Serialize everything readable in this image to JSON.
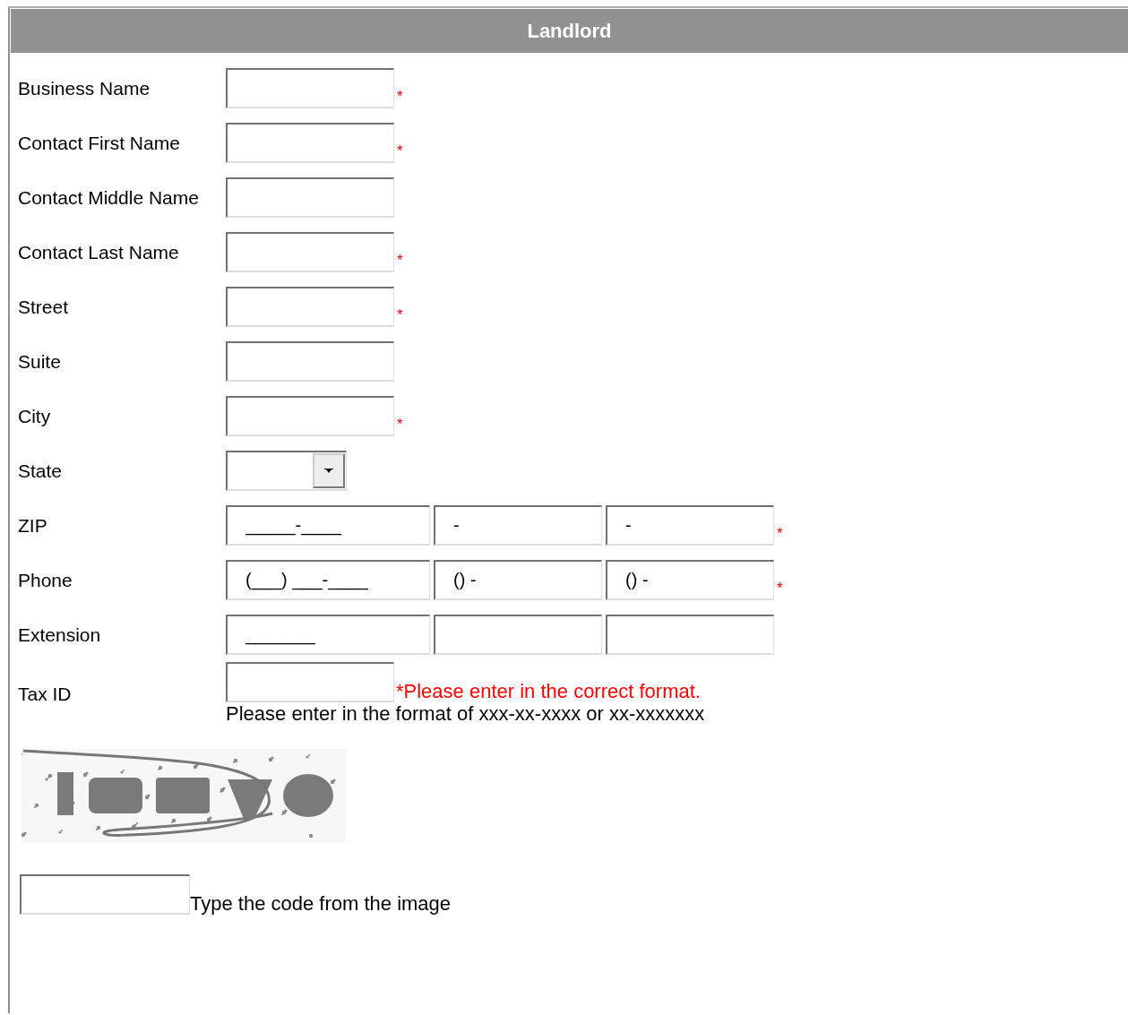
{
  "section": {
    "title": "Landlord"
  },
  "fields": [
    {
      "label": "Business Name",
      "kind": "text",
      "required_mark": "*"
    },
    {
      "label": "Contact First Name",
      "kind": "text",
      "required_mark": "*"
    },
    {
      "label": "Contact Middle Name",
      "kind": "text"
    },
    {
      "label": "Contact Last Name",
      "kind": "text",
      "required_mark": "*"
    },
    {
      "label": "Street",
      "kind": "text",
      "required_mark": "*"
    },
    {
      "label": "Suite",
      "kind": "text"
    },
    {
      "label": "City",
      "kind": "text",
      "required_mark": "*"
    },
    {
      "label": "State",
      "kind": "select"
    },
    {
      "label": "ZIP",
      "kind": "multi",
      "required_mark": "*",
      "inputs": [
        {
          "kind": "filled",
          "value": "_____-____"
        },
        {
          "kind": "filled",
          "value": "-"
        },
        {
          "kind": "filled",
          "value": "-"
        }
      ]
    },
    {
      "label": "Phone",
      "kind": "multi",
      "required_mark": "*",
      "inputs": [
        {
          "kind": "filled",
          "value": "(___) ___-____"
        },
        {
          "kind": "filled",
          "value": "() -"
        },
        {
          "kind": "filled",
          "value": "() -"
        }
      ]
    },
    {
      "label": "Extension",
      "kind": "multi",
      "inputs": [
        {
          "kind": "filled",
          "value": "_______"
        },
        {
          "kind": "empty"
        },
        {
          "kind": "empty"
        }
      ]
    },
    {
      "label": "Tax ID",
      "kind": "text",
      "error": "*Please enter in the correct format.",
      "hint": "Please enter in the format of xxx-xx-xxxx or xx-xxxxxxx"
    }
  ],
  "captcha": {
    "kind": "picture",
    "instruction": "Type the code from the image"
  }
}
